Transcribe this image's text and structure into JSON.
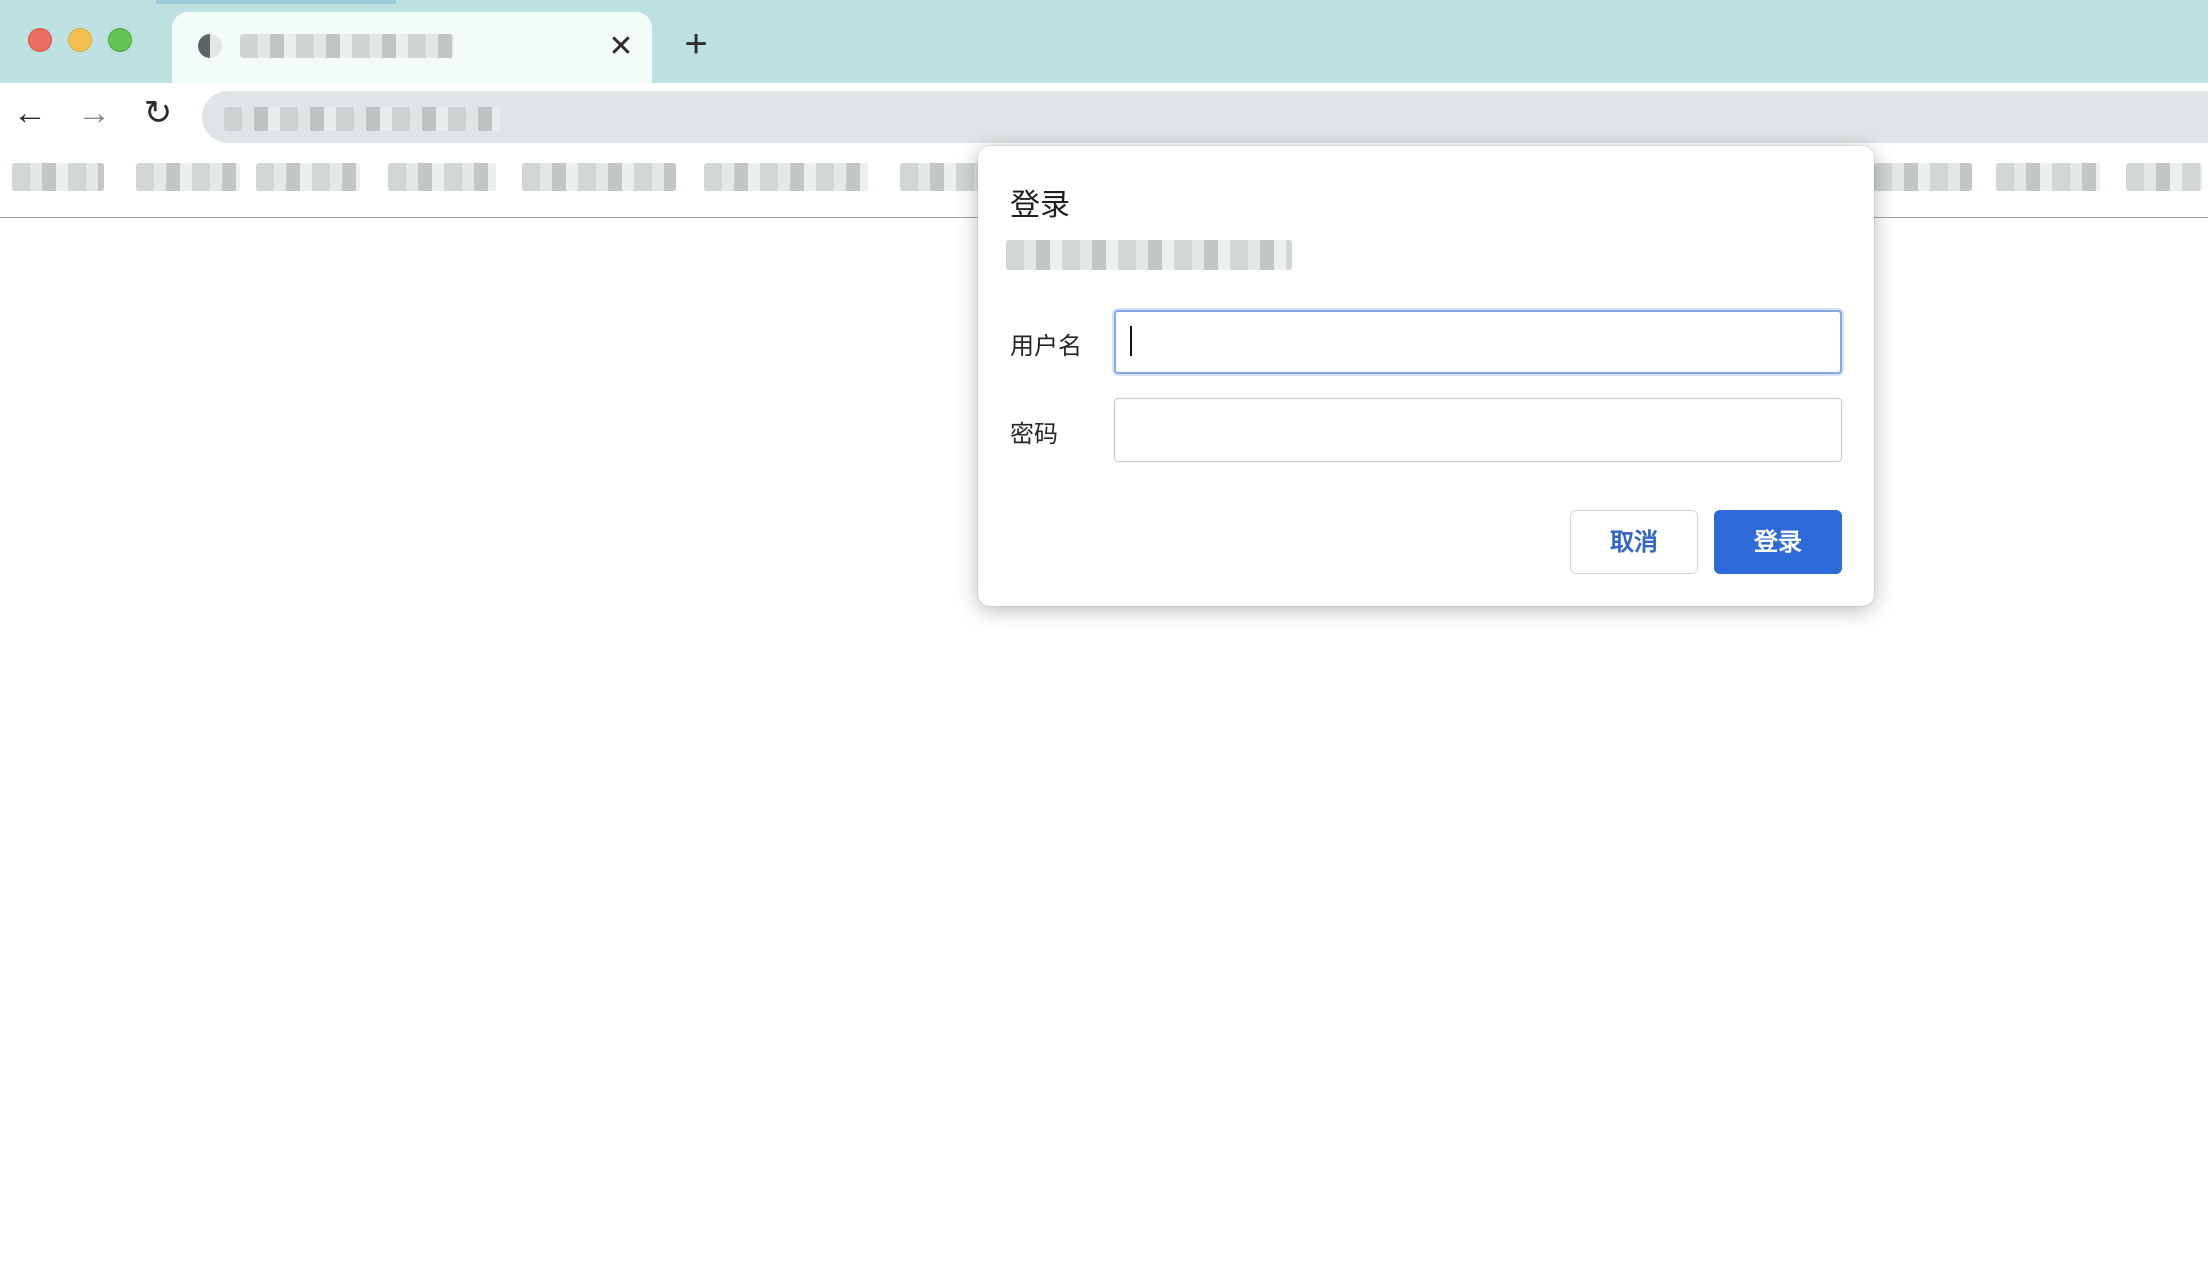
{
  "browser": {
    "tab": {
      "close_glyph": "✕"
    },
    "newtab_glyph": "+",
    "nav": {
      "back_glyph": "←",
      "forward_glyph": "→",
      "reload_glyph": "↻"
    }
  },
  "dialog": {
    "title": "登录",
    "username_label": "用户名",
    "username_value": "",
    "password_label": "密码",
    "password_value": "",
    "cancel_label": "取消",
    "login_label": "登录"
  },
  "colors": {
    "titlebar": "#bde0e1",
    "accent": "#2e6ad9",
    "focus_ring": "#83a8e6"
  }
}
